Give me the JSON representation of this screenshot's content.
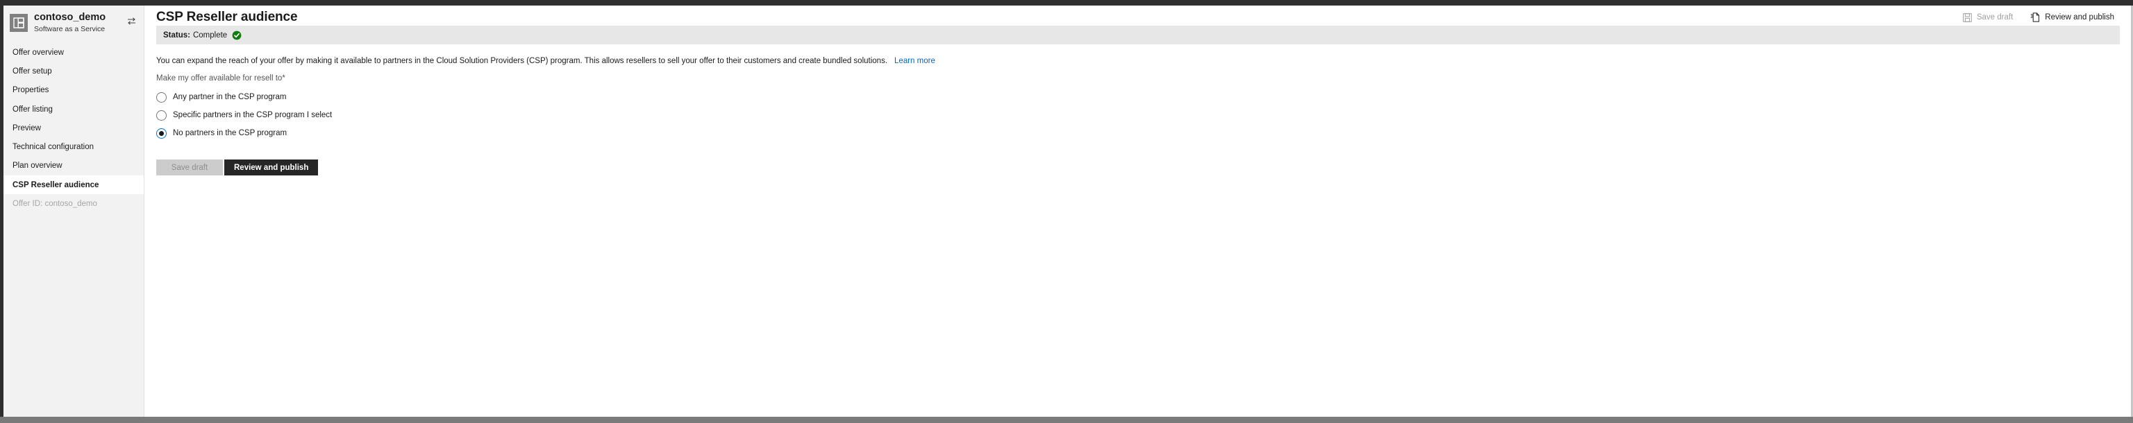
{
  "window": {
    "accent_dark": "#2f2f2f",
    "scrollbar_color": "#7a7a7a"
  },
  "sidebar": {
    "offer": {
      "name": "contoso_demo",
      "type": "Software as a Service",
      "icon": "grid-squares-icon",
      "switch_icon": "swap-arrows-icon"
    },
    "items": [
      {
        "label": "Offer overview",
        "selected": false,
        "muted": false
      },
      {
        "label": "Offer setup",
        "selected": false,
        "muted": false
      },
      {
        "label": "Properties",
        "selected": false,
        "muted": false
      },
      {
        "label": "Offer listing",
        "selected": false,
        "muted": false
      },
      {
        "label": "Preview",
        "selected": false,
        "muted": false
      },
      {
        "label": "Technical configuration",
        "selected": false,
        "muted": false
      },
      {
        "label": "Plan overview",
        "selected": false,
        "muted": false
      },
      {
        "label": "CSP Reseller audience",
        "selected": true,
        "muted": false
      },
      {
        "label": "Offer ID: contoso_demo",
        "selected": false,
        "muted": true
      }
    ]
  },
  "header": {
    "title": "CSP Reseller audience",
    "actions": [
      {
        "label": "Save draft",
        "icon": "save-disk-icon",
        "enabled": false
      },
      {
        "label": "Review and publish",
        "icon": "publish-page-icon",
        "enabled": true
      }
    ]
  },
  "status": {
    "label": "Status:",
    "value": "Complete",
    "icon": "green-check-circle-icon",
    "icon_color": "#107c10"
  },
  "description": {
    "text": "You can expand the reach of your offer by making it available to partners in the Cloud Solution Providers (CSP) program. This allows resellers to sell your offer to their customers and create bundled solutions.",
    "link_label": "Learn more",
    "link_color": "#0066cc"
  },
  "form": {
    "field_label": "Make my offer available for resell to",
    "required_marker": "*",
    "options": [
      {
        "label": "Any partner in the CSP program",
        "selected": false
      },
      {
        "label": "Specific partners in the CSP program I select",
        "selected": false
      },
      {
        "label": "No partners in the CSP program",
        "selected": true
      }
    ]
  },
  "footer": {
    "save_draft_label": "Save draft",
    "review_publish_label": "Review and publish"
  }
}
